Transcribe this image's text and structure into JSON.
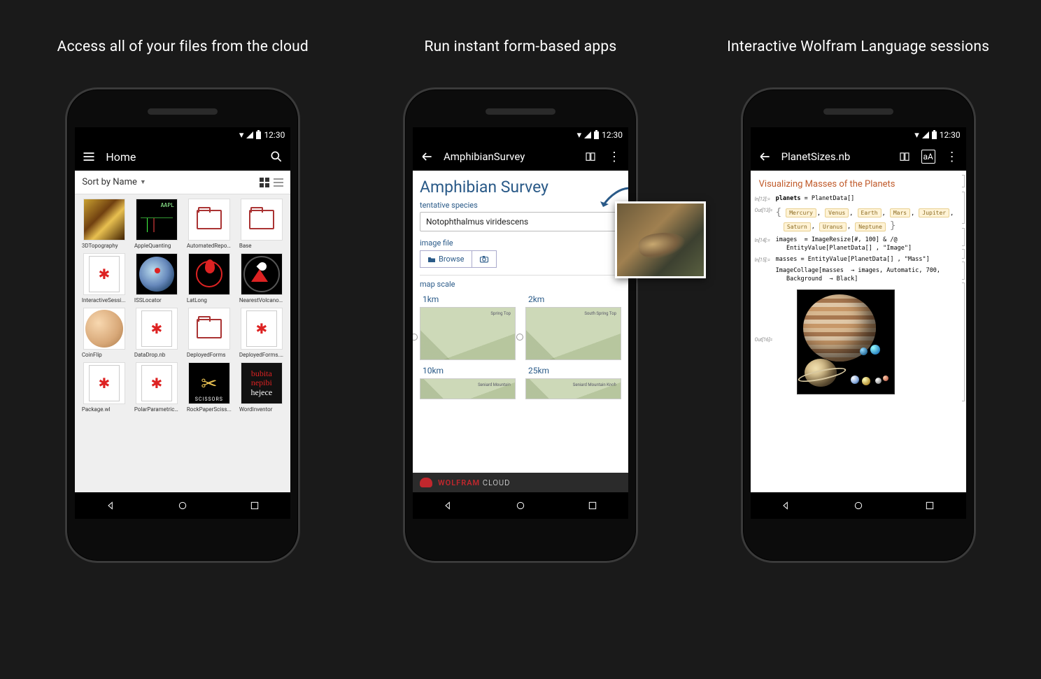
{
  "captions": {
    "c1": "Access all of your files from the cloud",
    "c2": "Run instant form-based apps",
    "c3": "Interactive Wolfram Language sessions"
  },
  "status": {
    "time": "12:30"
  },
  "screen1": {
    "title": "Home",
    "sort": "Sort by Name",
    "files": [
      "3DTopography",
      "AppleQuanting",
      "AutomatedRepor...",
      "Base",
      "InteractiveSessi...",
      "ISSLocator",
      "LatLong",
      "NearestVolcanoes",
      "CoinFlip",
      "DataDrop.nb",
      "DeployedForms",
      "DeployedForms.nb",
      "Package.wl",
      "PolarParametric.nb",
      "RockPaperSciss...",
      "WordInventor"
    ]
  },
  "screen2": {
    "title": "AmphibianSurvey",
    "heading": "Amphibian Survey",
    "f_species_label": "tentative species",
    "f_species_value": "Notophthalmus viridescens",
    "f_image_label": "image file",
    "browse": "Browse",
    "f_scale_label": "map scale",
    "scales": [
      "1km",
      "2km",
      "10km",
      "25km"
    ],
    "mapnote1": "Spring\nTop",
    "mapnote2": "South\nSpring\nTop",
    "mapnote3": "Seniard\nMountain",
    "mapnote4": "Seniard\nMountain\nKnob",
    "brand_w": "WOLFRAM",
    "brand_c": " CLOUD"
  },
  "screen3": {
    "title": "PlanetSizes.nb",
    "heading": "Visualizing Masses of the Planets",
    "in12": "In[12]:=",
    "code12a": "planets",
    "code12b": " = PlanetData[]",
    "out13": "Out[13]=",
    "planets": [
      "Mercury",
      "Venus",
      "Earth",
      "Mars",
      "Jupiter",
      "Saturn",
      "Uranus",
      "Neptune"
    ],
    "in14": "In[14]:=",
    "code14": "images  = ImageResize[#, 100] & /@\n   EntityValue[PlanetData[] , \"Image\"]",
    "in15": "In[15]:=",
    "code15": "masses  = EntityValue[PlanetData[] , \"Mass\"]",
    "in16": "",
    "code16": "ImageCollage[masses  → images, Automatic, 700,\n   Background  → Black]",
    "out16": "Out[16]="
  }
}
